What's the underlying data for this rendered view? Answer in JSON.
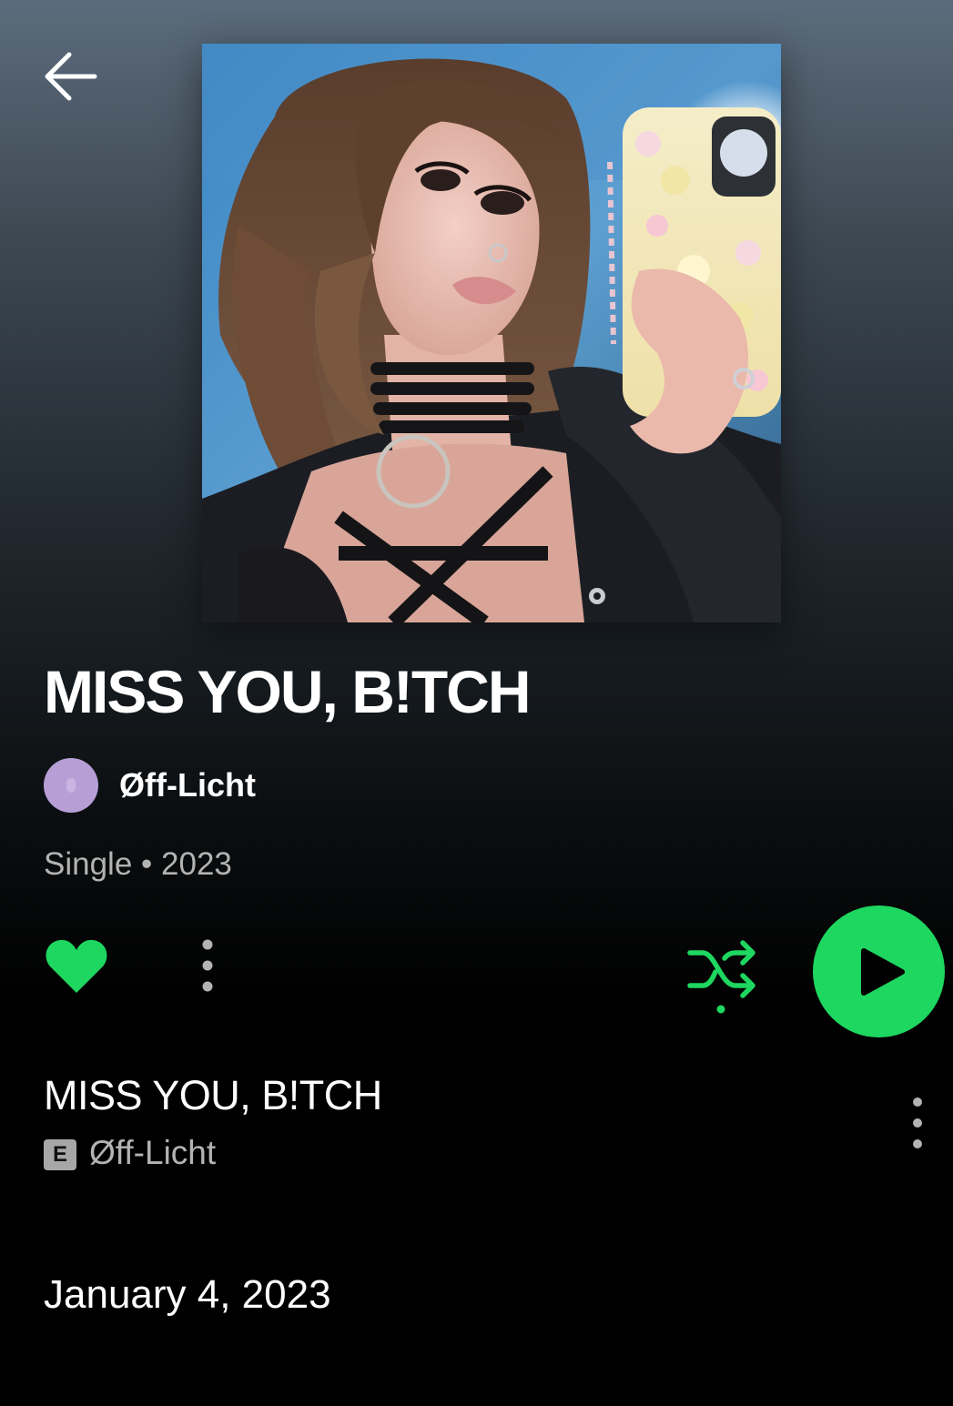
{
  "header": {
    "back_icon": "arrow-left-icon"
  },
  "album": {
    "title": "MISS YOU, B!TCH",
    "artist": "Øff-Licht",
    "type": "Single",
    "separator": "•",
    "year": "2023",
    "release_date": "January 4, 2023",
    "liked": true
  },
  "actions": {
    "like_icon": "heart-filled-icon",
    "more_icon": "more-vertical-icon",
    "shuffle_icon": "shuffle-icon",
    "play_icon": "play-icon"
  },
  "tracks": [
    {
      "title": "MISS YOU, B!TCH",
      "explicit_label": "E",
      "artist": "Øff-Licht"
    }
  ],
  "colors": {
    "accent": "#1ed760",
    "text_primary": "#ffffff",
    "text_secondary": "#b3b3b3",
    "background": "#000000"
  }
}
